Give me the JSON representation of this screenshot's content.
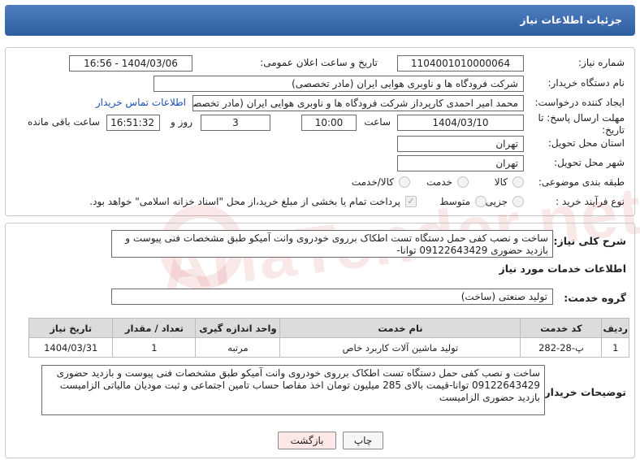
{
  "header": {
    "title": "جزئیات اطلاعات نیاز"
  },
  "form": {
    "need_number_label": "شماره نیاز:",
    "need_number": "1104001010000064",
    "announce_datetime_label": "تاریخ و ساعت اعلان عمومی:",
    "announce_datetime": "1404/03/06 - 16:56",
    "buyer_org_label": "نام دستگاه خریدار:",
    "buyer_org": "شرکت فرودگاه ها و ناوبری هوایی ایران (مادر تخصصی)",
    "requester_label": "ایجاد کننده درخواست:",
    "requester": "محمد امیر احمدی کارپرداز شرکت فرودگاه ها و ناوبری هوایی ایران (مادر تخصصی)",
    "contact_link": "اطلاعات تماس خریدار",
    "deadline_label_1": "مهلت ارسال پاسخ: تا",
    "deadline_label_2": "تاریخ:",
    "deadline_date": "1404/03/10",
    "time_label": "ساعت",
    "deadline_time": "10:00",
    "days_value": "3",
    "days_label": "روز و",
    "remaining_time": "16:51:32",
    "remaining_label": "ساعت باقی مانده",
    "province_label": "استان محل تحویل:",
    "province": "تهران",
    "city_label": "شهر محل تحویل:",
    "city": "تهران",
    "category_label": "طبقه بندی موضوعی:",
    "category_options": [
      "کالا",
      "خدمت",
      "کالا/خدمت"
    ],
    "process_label": "نوع فرآیند خرید :",
    "process_options": [
      "جزیی",
      "متوسط"
    ],
    "payment_note": "پرداخت تمام یا بخشی از مبلغ خرید،از محل \"اسناد خزانه اسلامی\" خواهد بود."
  },
  "summary": {
    "label": "شرح کلی نیاز:",
    "text": "ساخت و نصب کفی حمل دستگاه تست اطکاک برروی خودروی وانت آمیکو طبق مشخصات فنی پیوست و بازدید حضوری 09122643429 توانا-"
  },
  "services": {
    "section_title": "اطلاعات خدمات مورد نیاز",
    "group_label": "گروه خدمت:",
    "group_value": "تولید صنعتی (ساخت)",
    "columns": [
      "ردیف",
      "کد خدمت",
      "نام خدمت",
      "واحد اندازه گیری",
      "تعداد / مقدار",
      "تاریخ نیاز"
    ],
    "rows": [
      [
        "1",
        "پ-28-282",
        "تولید ماشین آلات کاربرد خاص",
        "مرتبه",
        "1",
        "1404/03/31"
      ]
    ]
  },
  "buyer_notes": {
    "label": "توضیحات خریدار:",
    "text": "ساخت و نصب کفی حمل دستگاه تست اطکاک برروی خودروی وانت آمیکو طبق مشخصات فنی پیوست و بازدید حضوری 09122643429 توانا-قیمت بالای 285 میلیون تومان اخذ مفاصا حساب تامین اجتماعی و ثبت مودیان مالیاتی الزامیست بازدید حضوری الزامیست"
  },
  "buttons": {
    "print": "چاپ",
    "back": "بازگشت"
  },
  "watermark": "AriaTender.net",
  "colors": {
    "header_bg": "#3b6aae",
    "link": "#1a4fb4",
    "back_button_bg": "#fde8e8"
  }
}
